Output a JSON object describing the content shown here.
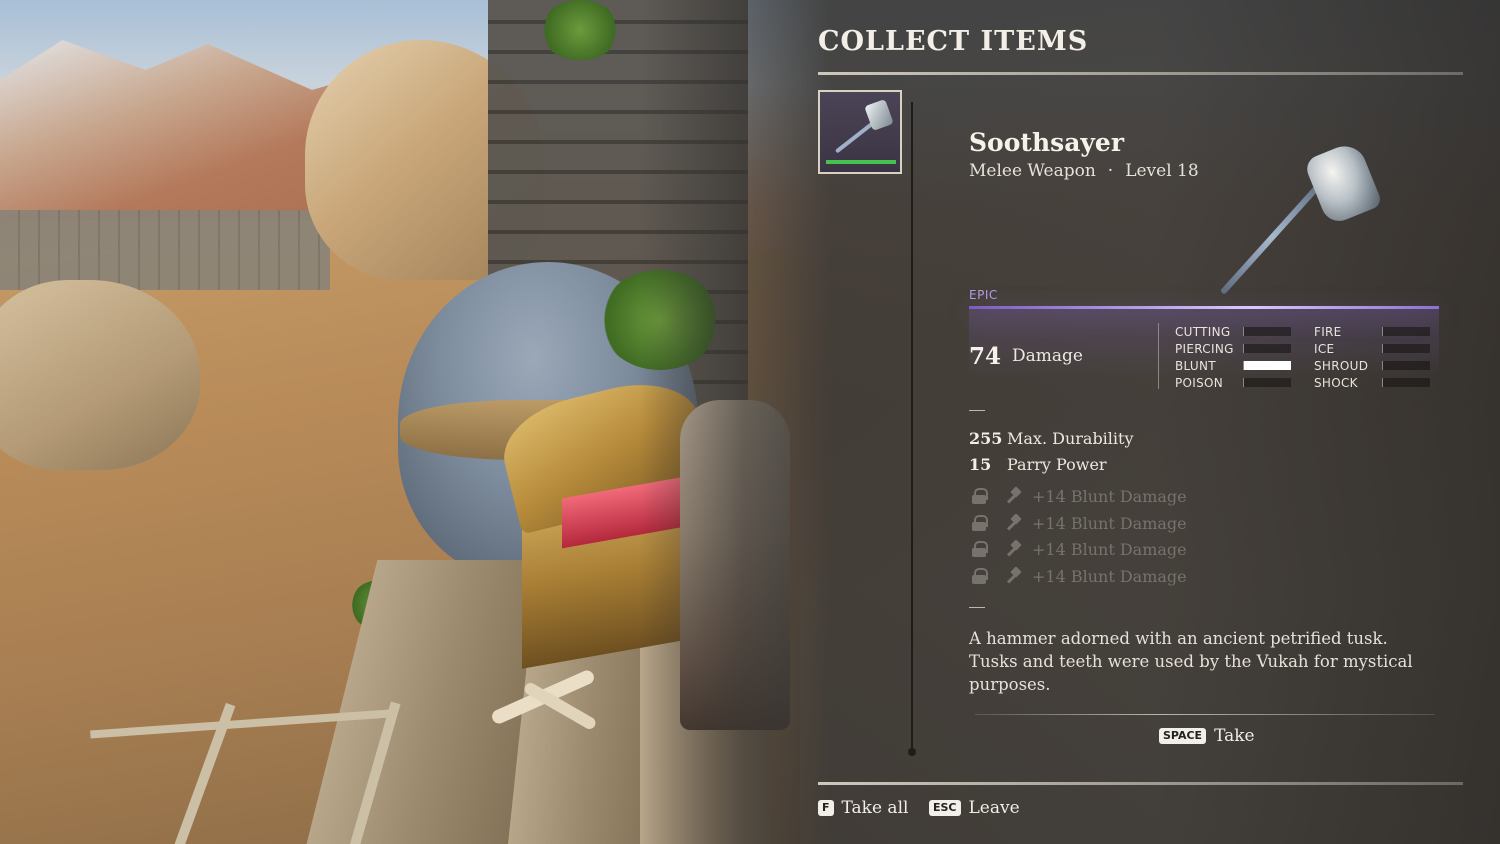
{
  "header": {
    "title": "COLLECT ITEMS"
  },
  "slot": {
    "icon": "hammer-icon",
    "durability_fraction": 1.0,
    "durability_color": "#46c04e"
  },
  "item": {
    "name": "Soothsayer",
    "type": "Melee Weapon",
    "separator": "·",
    "level": "Level 18",
    "rarity": "EPIC",
    "rarity_color": "#b39be6",
    "damage": {
      "value": "74",
      "label": "Damage"
    },
    "damage_types": [
      {
        "name": "CUTTING",
        "level": 0
      },
      {
        "name": "PIERCING",
        "level": 0
      },
      {
        "name": "BLUNT",
        "level": 1.0
      },
      {
        "name": "POISON",
        "level": 0
      },
      {
        "name": "FIRE",
        "level": 0
      },
      {
        "name": "ICE",
        "level": 0
      },
      {
        "name": "SHROUD",
        "level": 0
      },
      {
        "name": "SHOCK",
        "level": 0
      }
    ],
    "stats": [
      {
        "value": "255",
        "label": "Max. Durability"
      },
      {
        "value": "15",
        "label": "Parry Power"
      }
    ],
    "perks": [
      {
        "text": "+14 Blunt Damage",
        "locked": true,
        "icon": "hammer-icon"
      },
      {
        "text": "+14 Blunt Damage",
        "locked": true,
        "icon": "hammer-icon"
      },
      {
        "text": "+14 Blunt Damage",
        "locked": true,
        "icon": "hammer-icon"
      },
      {
        "text": "+14 Blunt Damage",
        "locked": true,
        "icon": "hammer-icon"
      }
    ],
    "description": "A hammer adorned with an ancient petrified tusk. Tusks and teeth were used by the Vukah for mystical purposes."
  },
  "actions": {
    "take": {
      "key": "SPACE",
      "label": "Take"
    },
    "take_all": {
      "key": "F",
      "label": "Take all"
    },
    "leave": {
      "key": "ESC",
      "label": "Leave"
    }
  }
}
